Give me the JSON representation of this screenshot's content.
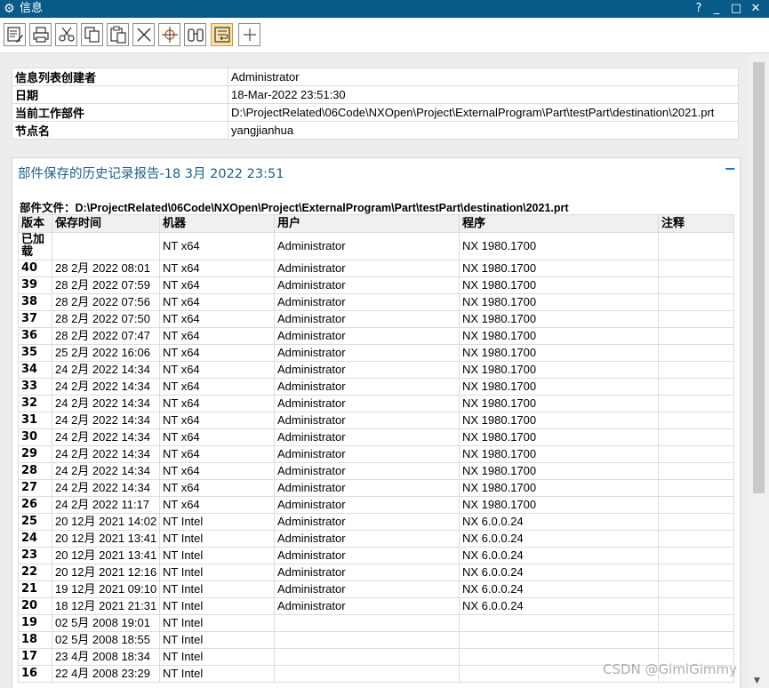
{
  "window": {
    "title": "信息",
    "help": "?",
    "minimize": "_",
    "maximize": "□",
    "close": "✕"
  },
  "toolbar": {
    "buttons": [
      {
        "name": "save-icon"
      },
      {
        "name": "print-icon"
      },
      {
        "name": "cut-icon"
      },
      {
        "name": "copy-icon"
      },
      {
        "name": "paste-icon"
      },
      {
        "name": "delete-icon"
      },
      {
        "name": "target-icon"
      },
      {
        "name": "find-icon"
      },
      {
        "name": "wrap-icon",
        "active": true
      },
      {
        "name": "add-icon"
      }
    ]
  },
  "info": {
    "rows": [
      {
        "key": "信息列表创建者",
        "value": "Administrator"
      },
      {
        "key": "日期",
        "value": "18-Mar-2022 23:51:30"
      },
      {
        "key": "当前工作部件",
        "value": "D:\\ProjectRelated\\06Code\\NXOpen\\Project\\ExternalProgram\\Part\\testPart\\destination\\2021.prt"
      },
      {
        "key": "节点名",
        "value": "yangjianhua"
      }
    ]
  },
  "report": {
    "title": "部件保存的历史记录报告-18 3月 2022 23:51",
    "collapse": "−",
    "part_file_label": "部件文件：",
    "part_file_value": "D:\\ProjectRelated\\06Code\\NXOpen\\Project\\ExternalProgram\\Part\\testPart\\destination\\2021.prt",
    "headers": [
      "版本",
      "保存时间",
      "机器",
      "用户",
      "程序",
      "注释"
    ],
    "rows": [
      [
        "已加载",
        "",
        "NT x64",
        "Administrator",
        "NX 1980.1700",
        ""
      ],
      [
        "40",
        "28 2月 2022 08:01",
        "NT x64",
        "Administrator",
        "NX 1980.1700",
        ""
      ],
      [
        "39",
        "28 2月 2022 07:59",
        "NT x64",
        "Administrator",
        "NX 1980.1700",
        ""
      ],
      [
        "38",
        "28 2月 2022 07:56",
        "NT x64",
        "Administrator",
        "NX 1980.1700",
        ""
      ],
      [
        "37",
        "28 2月 2022 07:50",
        "NT x64",
        "Administrator",
        "NX 1980.1700",
        ""
      ],
      [
        "36",
        "28 2月 2022 07:47",
        "NT x64",
        "Administrator",
        "NX 1980.1700",
        ""
      ],
      [
        "35",
        "25 2月 2022 16:06",
        "NT x64",
        "Administrator",
        "NX 1980.1700",
        ""
      ],
      [
        "34",
        "24 2月 2022 14:34",
        "NT x64",
        "Administrator",
        "NX 1980.1700",
        ""
      ],
      [
        "33",
        "24 2月 2022 14:34",
        "NT x64",
        "Administrator",
        "NX 1980.1700",
        ""
      ],
      [
        "32",
        "24 2月 2022 14:34",
        "NT x64",
        "Administrator",
        "NX 1980.1700",
        ""
      ],
      [
        "31",
        "24 2月 2022 14:34",
        "NT x64",
        "Administrator",
        "NX 1980.1700",
        ""
      ],
      [
        "30",
        "24 2月 2022 14:34",
        "NT x64",
        "Administrator",
        "NX 1980.1700",
        ""
      ],
      [
        "29",
        "24 2月 2022 14:34",
        "NT x64",
        "Administrator",
        "NX 1980.1700",
        ""
      ],
      [
        "28",
        "24 2月 2022 14:34",
        "NT x64",
        "Administrator",
        "NX 1980.1700",
        ""
      ],
      [
        "27",
        "24 2月 2022 14:34",
        "NT x64",
        "Administrator",
        "NX 1980.1700",
        ""
      ],
      [
        "26",
        "24 2月 2022 11:17",
        "NT x64",
        "Administrator",
        "NX 1980.1700",
        ""
      ],
      [
        "25",
        "20 12月 2021 14:02",
        "NT Intel",
        "Administrator",
        "NX 6.0.0.24",
        ""
      ],
      [
        "24",
        "20 12月 2021 13:41",
        "NT Intel",
        "Administrator",
        "NX 6.0.0.24",
        ""
      ],
      [
        "23",
        "20 12月 2021 13:41",
        "NT Intel",
        "Administrator",
        "NX 6.0.0.24",
        ""
      ],
      [
        "22",
        "20 12月 2021 12:16",
        "NT Intel",
        "Administrator",
        "NX 6.0.0.24",
        ""
      ],
      [
        "21",
        "19 12月 2021 09:10",
        "NT Intel",
        "Administrator",
        "NX 6.0.0.24",
        ""
      ],
      [
        "20",
        "18 12月 2021 21:31",
        "NT Intel",
        "Administrator",
        "NX 6.0.0.24",
        ""
      ],
      [
        "19",
        "02 5月 2008 19:01",
        "NT Intel",
        "",
        "",
        ""
      ],
      [
        "18",
        "02 5月 2008 18:55",
        "NT Intel",
        "",
        "",
        ""
      ],
      [
        "17",
        "23 4月 2008 18:34",
        "NT Intel",
        "",
        "",
        ""
      ],
      [
        "16",
        "22 4月 2008 23:29",
        "NT Intel",
        "",
        "",
        ""
      ]
    ]
  },
  "watermark": "CSDN @GimiGimmy",
  "colors": {
    "titlebar": "#085a88",
    "report_title": "#1a5f8a",
    "active_button": "#fbe3a9"
  }
}
